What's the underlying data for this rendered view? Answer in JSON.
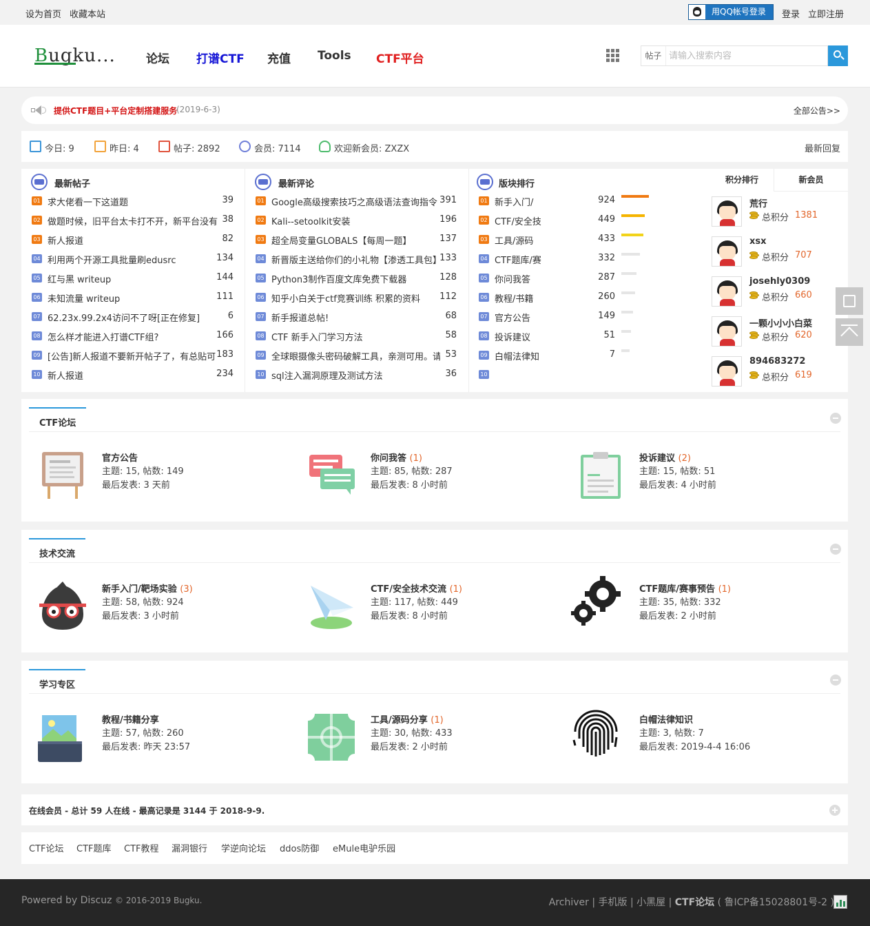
{
  "topbar": {
    "set_home": "设为首页",
    "bookmark": "收藏本站",
    "qq_login": "用QQ帐号登录",
    "login": "登录",
    "register": "立即注册"
  },
  "header": {
    "logo_text": "ugku",
    "logo_first": "B",
    "logo_dots": "...",
    "nav": [
      {
        "label": "论坛",
        "color": "#333333"
      },
      {
        "label": "打谱CTF",
        "color": "#1515d6"
      },
      {
        "label": "充值",
        "color": "#333333"
      },
      {
        "label": "Tools",
        "color": "#333333"
      },
      {
        "label": "CTF平台",
        "color": "#e01e1e"
      }
    ],
    "search_type": "帖子",
    "search_placeholder": "请输入搜索内容"
  },
  "notice": {
    "text": "提供CTF题目+平台定制搭建服务",
    "date": "(2019-6-3)",
    "all": "全部公告>>"
  },
  "stats": {
    "today": "今日: 9",
    "yesterday": "昨日: 4",
    "posts": "帖子: 2892",
    "members": "会员: 7114",
    "newest": "欢迎新会员: ZXZX",
    "latest_reply": "最新回复"
  },
  "latest_posts": {
    "title": "最新帖子",
    "items": [
      {
        "n": "01",
        "text": "求大佬看一下这道题",
        "count": "39"
      },
      {
        "n": "02",
        "text": "做题时候，旧平台太卡打不开，新平台没有",
        "count": "38"
      },
      {
        "n": "03",
        "text": "新人报道",
        "count": "82"
      },
      {
        "n": "04",
        "text": "利用两个开源工具批量刷edusrc",
        "count": "134"
      },
      {
        "n": "05",
        "text": "红与黑 writeup",
        "count": "144"
      },
      {
        "n": "06",
        "text": "未知流量 writeup",
        "count": "111"
      },
      {
        "n": "07",
        "text": "62.23x.99.2x4访问不了呀[正在修复]",
        "count": "6"
      },
      {
        "n": "08",
        "text": "怎么样才能进入打谱CTF组?",
        "count": "166"
      },
      {
        "n": "09",
        "text": "[公告]新人报道不要新开帖子了，有总贴可",
        "count": "183"
      },
      {
        "n": "10",
        "text": "新人报道",
        "count": "234"
      }
    ]
  },
  "latest_comments": {
    "title": "最新评论",
    "items": [
      {
        "n": "01",
        "text": "Google高级搜索技巧之高级语法查询指令",
        "count": "391"
      },
      {
        "n": "02",
        "text": "Kali--setoolkit安装",
        "count": "196"
      },
      {
        "n": "03",
        "text": "超全局变量GLOBALS【每周一题】",
        "count": "137"
      },
      {
        "n": "04",
        "text": "新晋版主送给你们的小礼物【渗透工具包】",
        "count": "133"
      },
      {
        "n": "05",
        "text": "Python3制作百度文库免费下载器",
        "count": "128"
      },
      {
        "n": "06",
        "text": "知乎小白关于ctf竞赛训练 积累的资料",
        "count": "112"
      },
      {
        "n": "07",
        "text": "新手报道总帖!",
        "count": "68"
      },
      {
        "n": "08",
        "text": "CTF 新手入门学习方法",
        "count": "58"
      },
      {
        "n": "09",
        "text": "全球眼摄像头密码破解工具，亲测可用。请",
        "count": "53"
      },
      {
        "n": "10",
        "text": "sql注入漏洞原理及测试方法",
        "count": "36"
      }
    ]
  },
  "board_rank": {
    "title": "版块排行",
    "items": [
      {
        "n": "01",
        "text": "新手入门/",
        "count": "924",
        "level": 1.0
      },
      {
        "n": "02",
        "text": "CTF/安全技",
        "count": "449",
        "level": 0.85
      },
      {
        "n": "03",
        "text": "工具/源码",
        "count": "433",
        "level": 0.8
      },
      {
        "n": "04",
        "text": "CTF题库/赛",
        "count": "332",
        "level": 0.68
      },
      {
        "n": "05",
        "text": "你问我答",
        "count": "287",
        "level": 0.55
      },
      {
        "n": "06",
        "text": "教程/书籍",
        "count": "260",
        "level": 0.5
      },
      {
        "n": "07",
        "text": "官方公告",
        "count": "149",
        "level": 0.42
      },
      {
        "n": "08",
        "text": "投诉建议",
        "count": "51",
        "level": 0.35
      },
      {
        "n": "09",
        "text": "白帽法律知",
        "count": "7",
        "level": 0.3
      },
      {
        "n": "10",
        "text": "",
        "count": "",
        "level": 0
      }
    ]
  },
  "point_rank": {
    "tab_points": "积分排行",
    "tab_members": "新会员",
    "label": "总积分",
    "members": [
      {
        "name": "荒行",
        "points": "1381"
      },
      {
        "name": "xsx",
        "points": "707"
      },
      {
        "name": "josehly0309",
        "points": "660"
      },
      {
        "name": "一颗小小小白菜",
        "points": "620"
      },
      {
        "name": "894683272",
        "points": "619"
      }
    ]
  },
  "sections": [
    {
      "title": "CTF论坛",
      "forums": [
        {
          "name": "官方公告",
          "new": "",
          "stat": "主题: 15, 帖数: 149",
          "last": "最后发表: 3 天前",
          "icon": "easel-board-icon"
        },
        {
          "name": "你问我答",
          "new": "(1)",
          "stat": "主题: 85, 帖数: 287",
          "last": "最后发表: 8 小时前",
          "icon": "chat-bubbles-icon"
        },
        {
          "name": "投诉建议",
          "new": "(2)",
          "stat": "主题: 15, 帖数: 51",
          "last": "最后发表: 4 小时前",
          "icon": "clipboard-icon"
        }
      ]
    },
    {
      "title": "技术交流",
      "forums": [
        {
          "name": "新手入门/靶场实验",
          "new": "(3)",
          "stat": "主题: 58, 帖数: 924",
          "last": "最后发表: 3 小时前",
          "icon": "ninja-glasses-icon"
        },
        {
          "name": "CTF/安全技术交流",
          "new": "(1)",
          "stat": "主题: 117, 帖数: 449",
          "last": "最后发表: 8 小时前",
          "icon": "paper-plane-icon"
        },
        {
          "name": "CTF题库/赛事预告",
          "new": "(1)",
          "stat": "主题: 35, 帖数: 332",
          "last": "最后发表: 2 小时前",
          "icon": "gears-icon"
        }
      ]
    },
    {
      "title": "学习专区",
      "forums": [
        {
          "name": "教程/书籍分享",
          "new": "",
          "stat": "主题: 57, 帖数: 260",
          "last": "最后发表: 昨天 23:57",
          "icon": "picture-tablet-icon"
        },
        {
          "name": "工具/源码分享",
          "new": "(1)",
          "stat": "主题: 30, 帖数: 433",
          "last": "最后发表: 2 小时前",
          "icon": "circuit-tile-icon"
        },
        {
          "name": "白帽法律知识",
          "new": "",
          "stat": "主题: 3, 帖数: 7",
          "last": "最后发表: 2019-4-4 16:06",
          "icon": "fingerprint-icon"
        }
      ]
    }
  ],
  "online": {
    "text": "在线会员 - 总计 59 人在线 - 最高记录是 3144 于 2018-9-9."
  },
  "friend_links": [
    "CTF论坛",
    "CTF题库",
    "CTF教程",
    "漏洞银行",
    "学逆向论坛",
    "ddos防御",
    "eMule电驴乐园"
  ],
  "footer": {
    "powered": "Powered by Discuz",
    "copyright": "© 2016-2019 Bugku.",
    "archiver": "Archiver",
    "mobile": "手机版",
    "darkroom": "小黑屋",
    "forum": "CTF论坛",
    "icp": "( 鲁ICP备15028801号-2 )",
    "sep": "|"
  },
  "colors": {
    "accent": "#2b98db",
    "rank1": "#f07a12",
    "rank2": "#f5b400",
    "rank3": "#f2d31a",
    "rank_other": "#e5e5e5",
    "num_hot": "#f07a12",
    "num_normal": "#6e8ad8"
  }
}
